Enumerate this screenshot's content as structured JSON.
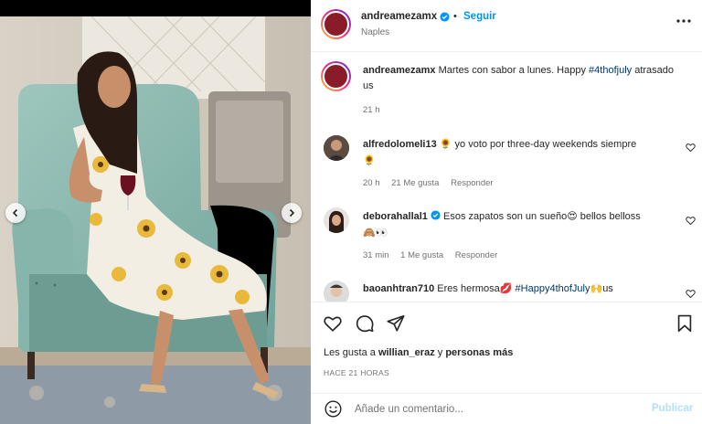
{
  "post": {
    "author": "andreamezamx",
    "follow_label": "Seguir",
    "separator": "•",
    "location": "Naples"
  },
  "caption": {
    "author": "andreamezamx",
    "text": "Martes con sabor a lunes. Happy ",
    "hashtag": "#4thofjuly",
    "text_after": " atrasado us",
    "time": "21 h"
  },
  "comments": [
    {
      "user": "alfredolomeli13",
      "verified": false,
      "emoji_before": "🌻",
      "text": " yo voto por three-day weekends siempre",
      "line2": "🌻",
      "time": "20 h",
      "likes": "21 Me gusta",
      "reply": "Responder"
    },
    {
      "user": "deborahallal1",
      "verified": true,
      "text": " Esos zapatos son un sueño",
      "emoji_mid": "😍",
      "text_after": " bellos belloss",
      "line2": "🙈👀",
      "time": "31 min",
      "likes": "1 Me gusta",
      "reply": "Responder"
    },
    {
      "user": "baoanhtran710",
      "verified": false,
      "text": " Eres hermosa",
      "emoji_mid": "💋",
      "hashtag": " #Happy4thofJuly",
      "emoji_end": "🙌",
      "text_after": "us"
    }
  ],
  "likes": {
    "prefix": "Les gusta a ",
    "user": "willian_eraz",
    "middle": " y ",
    "others": "personas más"
  },
  "post_time": "HACE 21 HORAS",
  "composer": {
    "placeholder": "Añade un comentario...",
    "publish_label": "Publicar"
  },
  "colors": {
    "accent": "#0095f6",
    "hashtag": "#00376b",
    "muted": "#737373",
    "publish_disabled": "#b2dffc"
  },
  "icons": [
    "chevron-left-icon",
    "chevron-right-icon",
    "verified-icon",
    "more-icon",
    "heart-icon",
    "comment-icon",
    "share-icon",
    "bookmark-icon",
    "emoji-icon"
  ]
}
